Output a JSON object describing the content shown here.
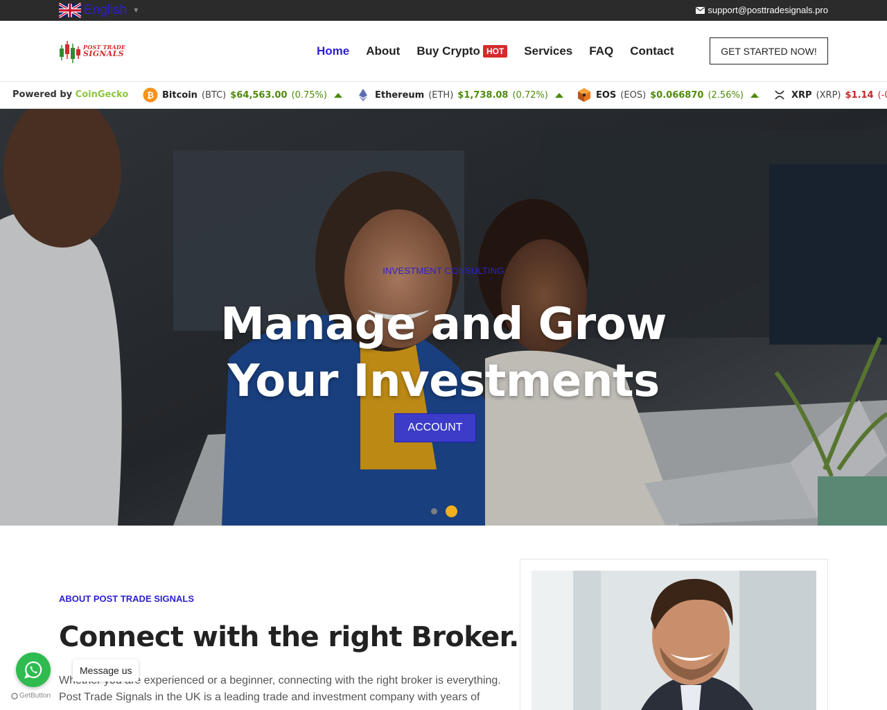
{
  "topbar": {
    "language": "English",
    "support_email": "support@posttradesignals.pro"
  },
  "brand": {
    "logo_line1": "POST TRADE",
    "logo_line2": "SIGNALS"
  },
  "nav": {
    "items": [
      {
        "label": "Home",
        "active": true
      },
      {
        "label": "About"
      },
      {
        "label": "Buy Crypto",
        "badge": "HOT"
      },
      {
        "label": "Services"
      },
      {
        "label": "FAQ"
      },
      {
        "label": "Contact"
      }
    ],
    "cta": "GET STARTED NOW!"
  },
  "ticker": {
    "powered_prefix": "Powered by",
    "powered_brand": "CoinGecko",
    "coins": [
      {
        "name": "Bitcoin",
        "symbol": "(BTC)",
        "price": "$64,563.00",
        "change": "(0.75%)",
        "direction": "up",
        "icon": "bitcoin-icon"
      },
      {
        "name": "Ethereum",
        "symbol": "(ETH)",
        "price": "$1,738.08",
        "change": "(0.72%)",
        "direction": "up",
        "icon": "ethereum-icon"
      },
      {
        "name": "EOS",
        "symbol": "(EOS)",
        "price": "$0.066870",
        "change": "(2.56%)",
        "direction": "up",
        "icon": "eos-icon"
      },
      {
        "name": "XRP",
        "symbol": "(XRP)",
        "price": "$1.14",
        "change": "(-0",
        "direction": "down",
        "icon": "xrp-icon"
      }
    ]
  },
  "hero": {
    "kicker": "INVESTMENT CONSULTING",
    "title_line1": "Manage and Grow",
    "title_line2": "Your Investments",
    "button": "ACCOUNT",
    "slides_active_index": 1
  },
  "about": {
    "kicker": "ABOUT POST TRADE SIGNALS",
    "title": "Connect with the right Broker.",
    "text": "Whether you are experienced or a beginner, connecting with the right broker is everything. Post Trade Signals in the UK is a leading trade and investment company with years of"
  },
  "whatsapp": {
    "message": "Message us",
    "provider": "GetButton"
  },
  "colors": {
    "accent": "#2d1fcf",
    "hot": "#d42b2b",
    "up": "#4e8a0b",
    "down": "#c62828",
    "whatsapp": "#2fbb4f",
    "slider_active": "#f2b01e"
  }
}
